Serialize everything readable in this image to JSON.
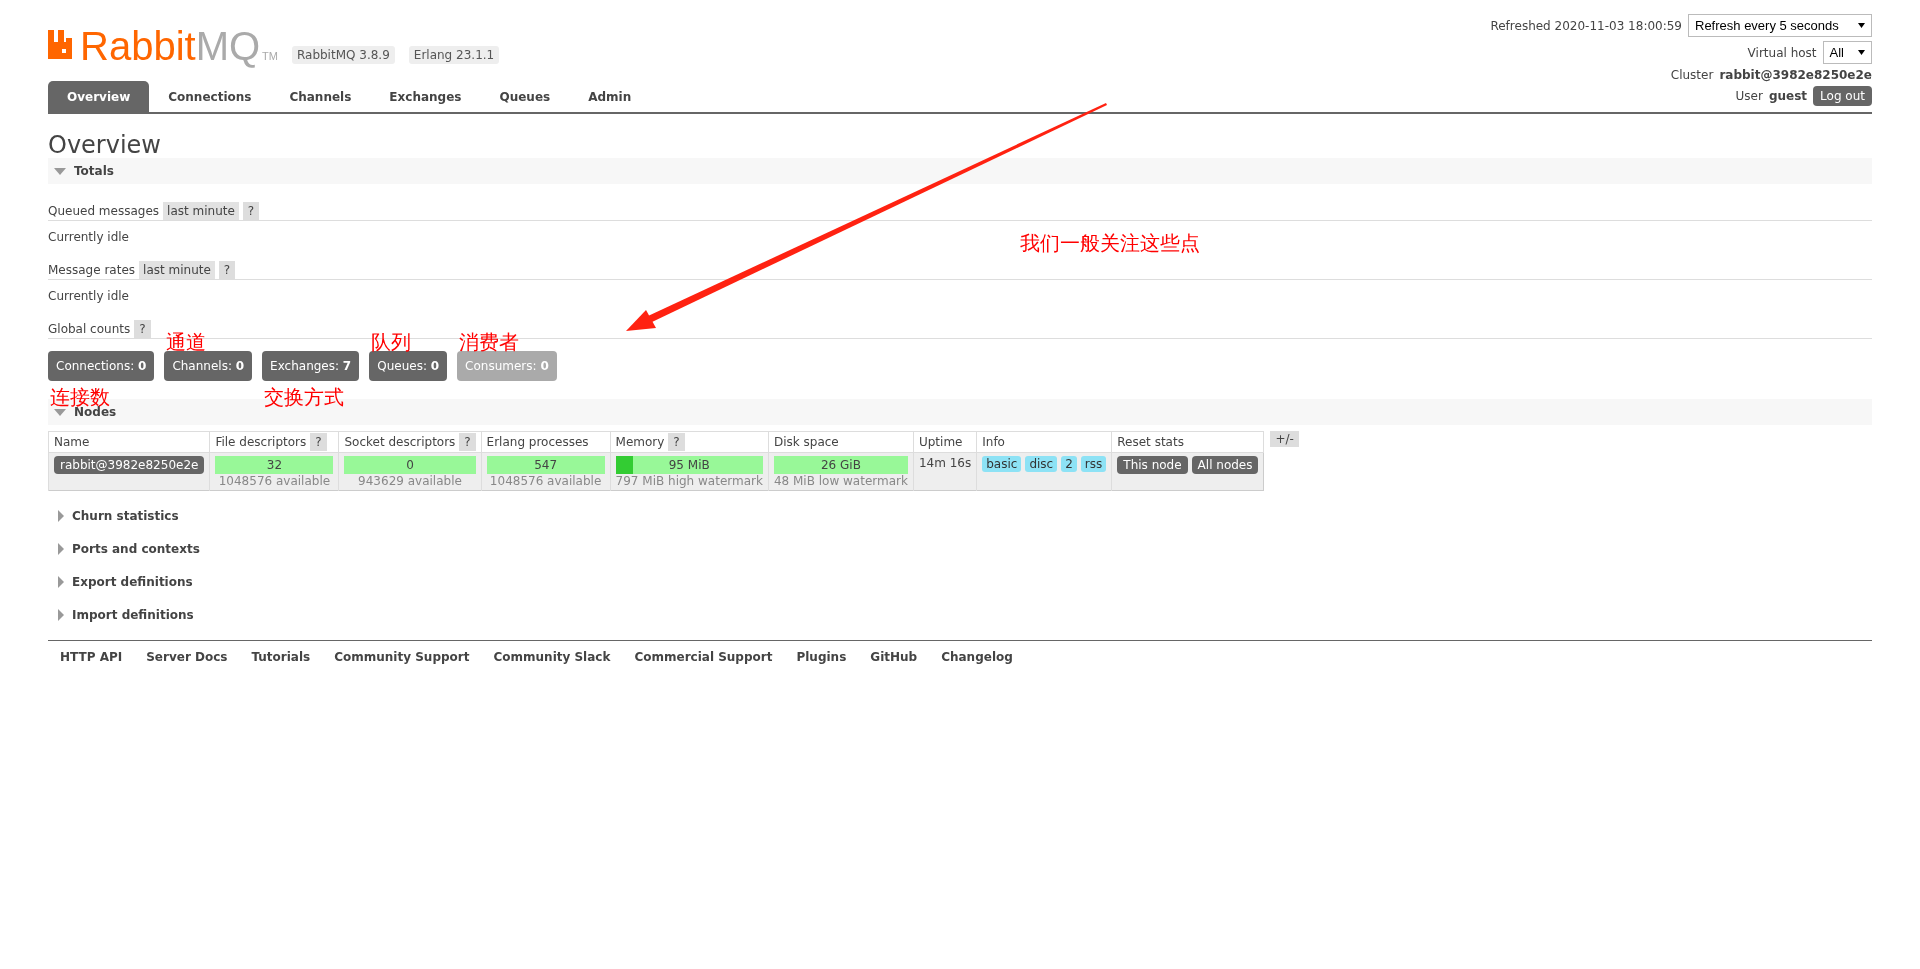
{
  "header": {
    "logo": {
      "brand": "Rabbit",
      "suffix": "MQ",
      "mark": "TM"
    },
    "versions": [
      "RabbitMQ 3.8.9",
      "Erlang 23.1.1"
    ],
    "refreshed": "Refreshed 2020-11-03 18:00:59",
    "refresh_select": {
      "value": "Refresh every 5 seconds"
    },
    "virtual_host": {
      "label": "Virtual host",
      "value": "All"
    },
    "cluster": {
      "label": "Cluster",
      "value": "rabbit@3982e8250e2e"
    },
    "user": {
      "label": "User",
      "value": "guest"
    },
    "logout": "Log out"
  },
  "tabs": [
    {
      "label": "Overview",
      "selected": true
    },
    {
      "label": "Connections",
      "selected": false
    },
    {
      "label": "Channels",
      "selected": false
    },
    {
      "label": "Exchanges",
      "selected": false
    },
    {
      "label": "Queues",
      "selected": false
    },
    {
      "label": "Admin",
      "selected": false
    }
  ],
  "page_title": "Overview",
  "totals": {
    "title": "Totals",
    "expanded": true,
    "rows": [
      {
        "kind": "heading",
        "label": "Queued messages",
        "filter": "last minute",
        "help": "?"
      },
      {
        "kind": "text",
        "text": "Currently idle"
      },
      {
        "kind": "heading",
        "label": "Message rates",
        "filter": "last minute",
        "help": "?"
      },
      {
        "kind": "text",
        "text": "Currently idle"
      },
      {
        "kind": "heading",
        "label": "Global counts",
        "help": "?"
      }
    ],
    "counts": [
      {
        "label": "Connections:",
        "count": "0",
        "disabled": false,
        "note": {
          "text": "连接数",
          "below": true
        }
      },
      {
        "label": "Channels:",
        "count": "0",
        "disabled": false,
        "note": {
          "text": "通道",
          "below": false
        }
      },
      {
        "label": "Exchanges:",
        "count": "7",
        "disabled": false,
        "note": {
          "text": "交换方式",
          "below": true
        }
      },
      {
        "label": "Queues:",
        "count": "0",
        "disabled": false,
        "note": {
          "text": "队列",
          "below": false
        }
      },
      {
        "label": "Consumers:",
        "count": "0",
        "disabled": true,
        "note": {
          "text": "消费者",
          "below": false
        }
      }
    ]
  },
  "nodes": {
    "title": "Nodes",
    "expanded": true,
    "toggle": "+/-",
    "columns": [
      {
        "label": "Name"
      },
      {
        "label": "File descriptors",
        "help": "?"
      },
      {
        "label": "Socket descriptors",
        "help": "?"
      },
      {
        "label": "Erlang processes"
      },
      {
        "label": "Memory",
        "help": "?"
      },
      {
        "label": "Disk space"
      },
      {
        "label": "Uptime"
      },
      {
        "label": "Info"
      },
      {
        "label": "Reset stats"
      }
    ],
    "rows": [
      {
        "cells": [
          {
            "kind": "name",
            "value": "rabbit@3982e8250e2e"
          },
          {
            "kind": "bar",
            "value": "32",
            "detail": "1048576 available"
          },
          {
            "kind": "bar",
            "value": "0",
            "detail": "943629 available"
          },
          {
            "kind": "bar",
            "value": "547",
            "detail": "1048576 available"
          },
          {
            "kind": "bar",
            "value": "95 MiB",
            "detail": "797 MiB high watermark",
            "level": 0.12
          },
          {
            "kind": "bar",
            "value": "26 GiB",
            "detail": "48 MiB low watermark"
          },
          {
            "kind": "text",
            "value": "14m 16s"
          },
          {
            "kind": "tags",
            "values": [
              "basic",
              "disc",
              "2",
              "rss"
            ]
          },
          {
            "kind": "buttons",
            "values": [
              "This node",
              "All nodes"
            ]
          }
        ]
      }
    ]
  },
  "sections": [
    {
      "title": "Churn statistics",
      "expanded": false
    },
    {
      "title": "Ports and contexts",
      "expanded": false
    },
    {
      "title": "Export definitions",
      "expanded": false
    },
    {
      "title": "Import definitions",
      "expanded": false
    }
  ],
  "footer": {
    "links": [
      "HTTP API",
      "Server Docs",
      "Tutorials",
      "Community Support",
      "Community Slack",
      "Commercial Support",
      "Plugins",
      "GitHub",
      "Changelog"
    ]
  },
  "annotation": {
    "text": "我们一般关注这些点"
  }
}
